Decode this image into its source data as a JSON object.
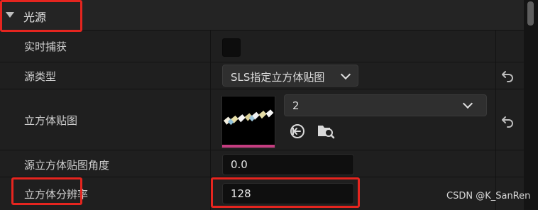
{
  "section": {
    "title": "光源"
  },
  "rows": {
    "realtime_capture": {
      "label": "实时捕获",
      "checked": false
    },
    "source_type": {
      "label": "源类型",
      "value": "SLS指定立方体贴图"
    },
    "cubemap": {
      "label": "立方体贴图",
      "value": "2"
    },
    "source_cubemap_angle": {
      "label": "源立方体贴图角度",
      "value": "0.0"
    },
    "cubemap_resolution": {
      "label": "立方体分辨率",
      "value": "128"
    }
  },
  "watermark": "CSDN @K_SanRen",
  "colors": {
    "highlight": "#e5251f",
    "thumbnail_bar": "#c43d80"
  },
  "icons": [
    "collapse-triangle-icon",
    "chevron-down-icon",
    "reset-arrow-icon",
    "use-selected-icon",
    "browse-folder-icon"
  ]
}
